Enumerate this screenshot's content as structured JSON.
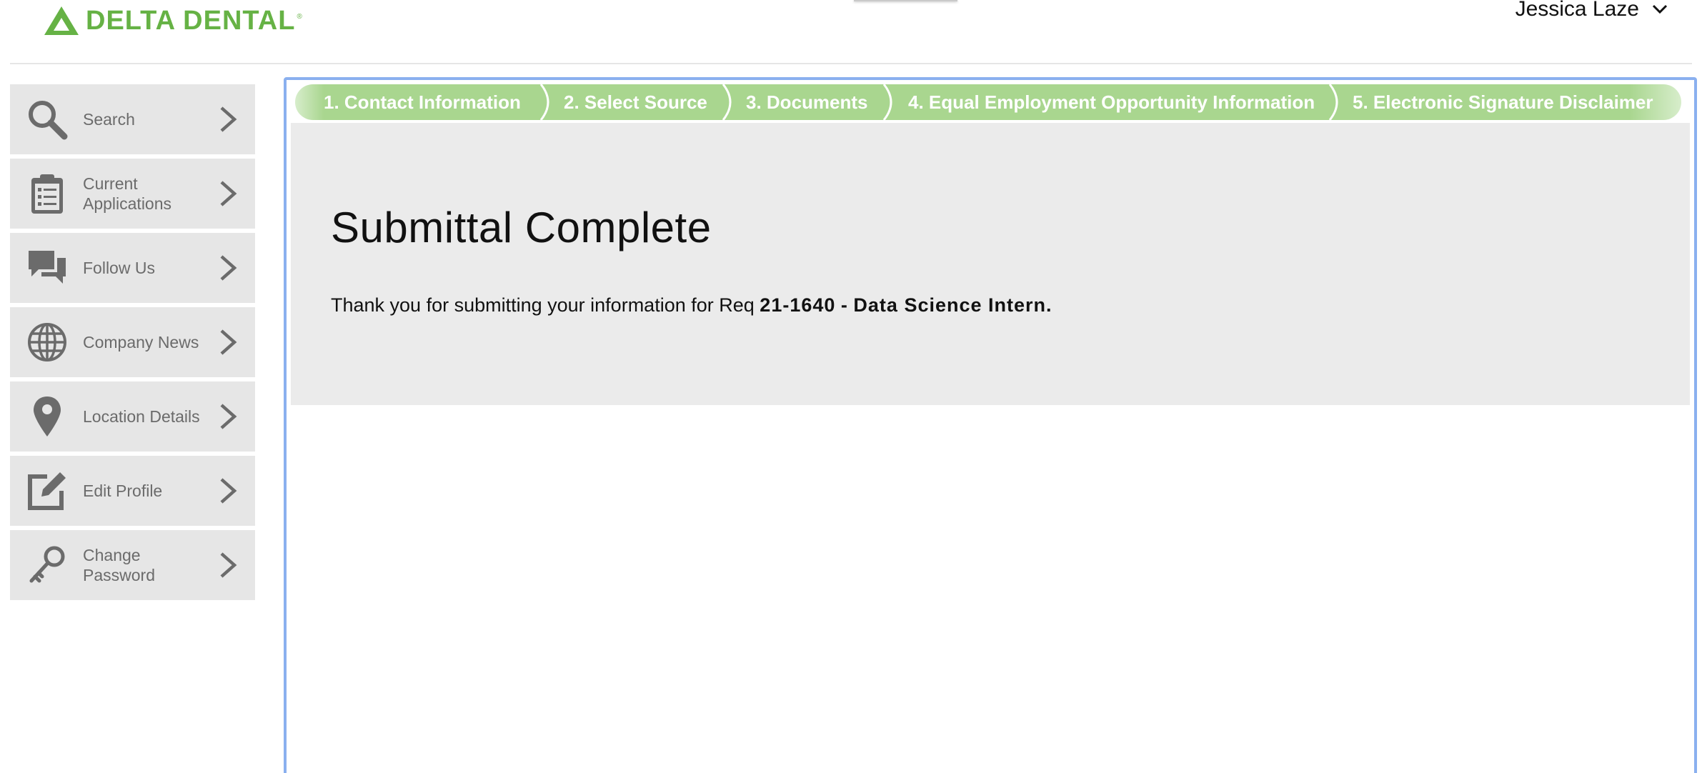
{
  "header": {
    "logo_text": "DELTA DENTAL",
    "logo_reg": "®",
    "user_name": "Jessica Laze"
  },
  "sidebar": {
    "items": [
      {
        "label": "Search",
        "icon": "search-icon"
      },
      {
        "label": "Current Applications",
        "icon": "clipboard-icon"
      },
      {
        "label": "Follow Us",
        "icon": "chat-bubbles-icon"
      },
      {
        "label": "Company News",
        "icon": "globe-icon"
      },
      {
        "label": "Location Details",
        "icon": "map-pin-icon"
      },
      {
        "label": "Edit Profile",
        "icon": "edit-icon"
      },
      {
        "label": "Change Password",
        "icon": "key-icon"
      }
    ]
  },
  "steps": [
    {
      "label": "1. Contact Information"
    },
    {
      "label": "2. Select Source"
    },
    {
      "label": "3. Documents"
    },
    {
      "label": "4. Equal Employment Opportunity Information"
    },
    {
      "label": "5. Electronic Signature Disclaimer"
    }
  ],
  "content": {
    "title": "Submittal Complete",
    "message_prefix": "Thank you for submitting your information for Req",
    "req_id": "21-1640",
    "dash": "-",
    "job_title": "Data Science Intern."
  },
  "colors": {
    "brand_green": "#66b245",
    "step_green": "#a9d68f",
    "frame_blue": "#8ab0ef",
    "sidebar_bg": "#e6e6e6",
    "icon_gray": "#6b6b6b"
  }
}
